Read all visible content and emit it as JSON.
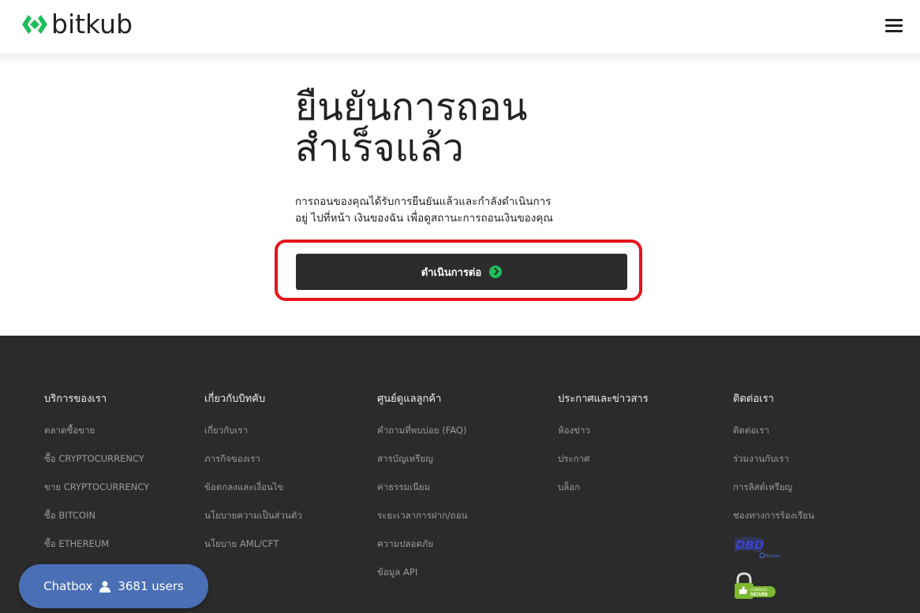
{
  "header": {
    "logo_text": "bitkub",
    "menu_icon": "hamburger-menu-icon"
  },
  "main": {
    "title_line1": "ยืนยันการถอน",
    "title_line2": "สำเร็จแล้ว",
    "description_line1": "การถอนของคุณได้รับการยืนยันแล้วและกำลังดำเนินการ",
    "description_line2": "อยู่ ไปที่หน้า เงินของฉัน เพื่อดูสถานะการถอนเงินของคุณ",
    "continue_label": "ดำเนินการต่อ"
  },
  "footer": {
    "col1": {
      "title": "บริการของเรา",
      "links": [
        "ตลาดซื้อขาย",
        "ซื้อ CRYPTOCURRENCY",
        "ขาย CRYPTOCURRENCY",
        "ซื้อ BITCOIN",
        "ซื้อ ETHEREUM"
      ]
    },
    "col2": {
      "title": "เกี่ยวกับบิทคับ",
      "links": [
        "เกี่ยวกับเรา",
        "ภารกิจของเรา",
        "ข้อตกลงและเงื่อนไข",
        "นโยบายความเป็นส่วนตัว",
        "นโยบาย AML/CFT"
      ]
    },
    "col3": {
      "title": "ศูนย์ดูแลลูกค้า",
      "links": [
        "คำถามที่พบบ่อย (FAQ)",
        "สารบัญเหรียญ",
        "ค่าธรรมเนียม",
        "ระยะเวลาการฝาก/ถอน",
        "ความปลอดภัย",
        "ข้อมูล API"
      ]
    },
    "col4": {
      "title": "ประกาศและข่าวสาร",
      "links": [
        "ห้องข่าว",
        "ประกาศ",
        "บล็อก"
      ]
    },
    "col5": {
      "title": "ติดต่อเรา",
      "links": [
        "ติดต่อเรา",
        "ร่วมงานกับเรา",
        "การลิสต์เหรียญ",
        "ช่องทางการร้องเรียน"
      ],
      "dbd_badge": "DBD",
      "dbd_badge_sub": "Registered",
      "secure_badge": "COMODO SECURE"
    }
  },
  "chatbox": {
    "label": "Chatbox",
    "users": "3681 users"
  },
  "colors": {
    "accent_red": "#e4141b",
    "button_dark": "#2c2c2c",
    "footer_bg": "#2b2b2b",
    "brand_green": "#1fbd5a",
    "chatbox_blue": "#4a6fb5"
  }
}
